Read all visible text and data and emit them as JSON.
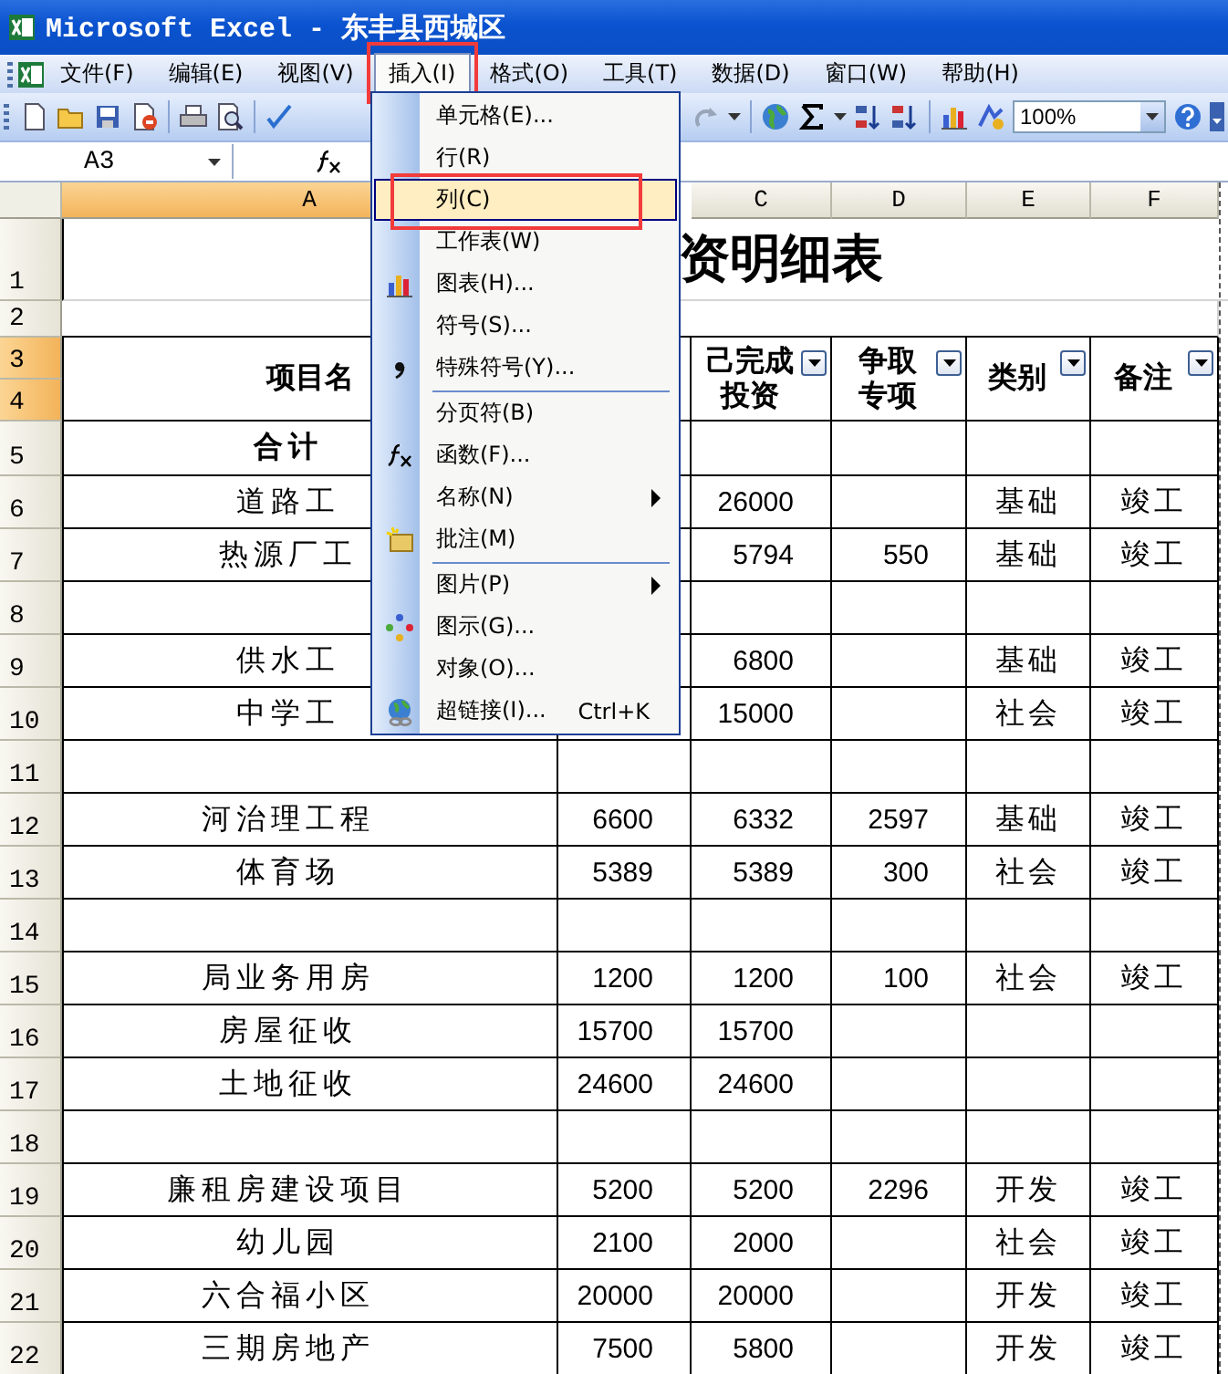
{
  "window": {
    "title": "Microsoft Excel - 东丰县西城区"
  },
  "menu_bar": [
    {
      "label": "文件(F)",
      "selected": false,
      "annotated": false
    },
    {
      "label": "编辑(E)",
      "selected": false,
      "annotated": false
    },
    {
      "label": "视图(V)",
      "selected": false,
      "annotated": false
    },
    {
      "label": "插入(I)",
      "selected": true,
      "annotated": true
    },
    {
      "label": "格式(O)",
      "selected": false,
      "annotated": false
    },
    {
      "label": "工具(T)",
      "selected": false,
      "annotated": false
    },
    {
      "label": "数据(D)",
      "selected": false,
      "annotated": false
    },
    {
      "label": "窗口(W)",
      "selected": false,
      "annotated": false
    },
    {
      "label": "帮助(H)",
      "selected": false,
      "annotated": false
    }
  ],
  "toolbar": {
    "zoom": "100%"
  },
  "formula_bar": {
    "name_box": "A3"
  },
  "sheet": {
    "column_headers": {
      "a": {
        "label": "A",
        "selected": true
      },
      "c": {
        "label": "C",
        "selected": false
      },
      "d": {
        "label": "D",
        "selected": false
      },
      "e": {
        "label": "E",
        "selected": false
      },
      "f": {
        "label": "F",
        "selected": false
      }
    },
    "rows": [
      {
        "number": "1",
        "selected": false,
        "kind": "title",
        "title": "资明细表"
      },
      {
        "number": "2",
        "selected": false,
        "kind": "blank"
      },
      {
        "number": "3",
        "selected": true,
        "kind": "header",
        "a": {
          "lines": [
            "项目名"
          ],
          "filter": false
        },
        "c": {
          "lines": [
            "己完成",
            "投资"
          ],
          "filter": true
        },
        "d": {
          "lines": [
            "争取",
            "专项"
          ],
          "filter": true
        },
        "e": {
          "lines": [
            "类别"
          ],
          "filter": true
        },
        "f": {
          "lines": [
            "备注"
          ],
          "filter": true
        }
      },
      {
        "number": "4",
        "selected": true,
        "kind": "continued"
      },
      {
        "number": "5",
        "selected": false,
        "kind": "total",
        "a": "合计"
      },
      {
        "number": "6",
        "selected": false,
        "kind": "data",
        "a": "道路工",
        "c": "26000",
        "e": "基础",
        "f": "竣工"
      },
      {
        "number": "7",
        "selected": false,
        "kind": "data",
        "a": "热源厂工",
        "c": "5794",
        "d": "550",
        "e": "基础",
        "f": "竣工"
      },
      {
        "number": "8",
        "selected": false,
        "kind": "data"
      },
      {
        "number": "9",
        "selected": false,
        "kind": "data",
        "a": "供水工",
        "c": "6800",
        "e": "基础",
        "f": "竣工"
      },
      {
        "number": "10",
        "selected": false,
        "kind": "data",
        "a": "中学工",
        "c": "15000",
        "e": "社会",
        "f": "竣工"
      },
      {
        "number": "11",
        "selected": false,
        "kind": "data"
      },
      {
        "number": "12",
        "selected": false,
        "kind": "data",
        "a": "河治理工程",
        "b": "6600",
        "c": "6332",
        "d": "2597",
        "e": "基础",
        "f": "竣工"
      },
      {
        "number": "13",
        "selected": false,
        "kind": "data",
        "a": "体育场",
        "b": "5389",
        "c": "5389",
        "d": "300",
        "e": "社会",
        "f": "竣工"
      },
      {
        "number": "14",
        "selected": false,
        "kind": "data"
      },
      {
        "number": "15",
        "selected": false,
        "kind": "data",
        "a": "局业务用房",
        "b": "1200",
        "c": "1200",
        "d": "100",
        "e": "社会",
        "f": "竣工"
      },
      {
        "number": "16",
        "selected": false,
        "kind": "data",
        "a": "房屋征收",
        "b": "15700",
        "c": "15700"
      },
      {
        "number": "17",
        "selected": false,
        "kind": "data",
        "a": "土地征收",
        "b": "24600",
        "c": "24600"
      },
      {
        "number": "18",
        "selected": false,
        "kind": "data"
      },
      {
        "number": "19",
        "selected": false,
        "kind": "data",
        "a": "廉租房建设项目",
        "b": "5200",
        "c": "5200",
        "d": "2296",
        "e": "开发",
        "f": "竣工"
      },
      {
        "number": "20",
        "selected": false,
        "kind": "data",
        "a": "幼儿园",
        "b": "2100",
        "c": "2000",
        "e": "社会",
        "f": "竣工"
      },
      {
        "number": "21",
        "selected": false,
        "kind": "data",
        "a": "六合福小区",
        "b": "20000",
        "c": "20000",
        "e": "开发",
        "f": "竣工"
      },
      {
        "number": "22",
        "selected": false,
        "kind": "data",
        "a": "三期房地产",
        "b": "7500",
        "c": "5800",
        "e": "开发",
        "f": "竣工"
      }
    ]
  },
  "insert_menu": {
    "items": [
      {
        "label": "单元格(E)...",
        "kind": "plain",
        "selected": false,
        "annotated": false,
        "separator_before": false,
        "submenu": false
      },
      {
        "label": "行(R)",
        "kind": "plain",
        "selected": false,
        "annotated": false,
        "separator_before": false,
        "submenu": false
      },
      {
        "label": "列(C)",
        "kind": "plain",
        "selected": true,
        "annotated": true,
        "separator_before": false,
        "submenu": false
      },
      {
        "label": "工作表(W)",
        "kind": "plain",
        "selected": false,
        "annotated": false,
        "separator_before": false,
        "submenu": false
      },
      {
        "label": "图表(H)...",
        "kind": "chart",
        "selected": false,
        "annotated": false,
        "separator_before": false,
        "submenu": false
      },
      {
        "label": "符号(S)...",
        "kind": "plain",
        "selected": false,
        "annotated": false,
        "separator_before": false,
        "submenu": false
      },
      {
        "label": "特殊符号(Y)...",
        "kind": "symbol",
        "selected": false,
        "annotated": false,
        "separator_before": false,
        "submenu": false
      },
      {
        "label": "分页符(B)",
        "kind": "plain",
        "selected": false,
        "annotated": false,
        "separator_before": true,
        "submenu": false
      },
      {
        "label": "函数(F)...",
        "kind": "function",
        "selected": false,
        "annotated": false,
        "separator_before": false,
        "submenu": false
      },
      {
        "label": "名称(N)",
        "kind": "plain",
        "selected": false,
        "annotated": false,
        "separator_before": false,
        "submenu": true
      },
      {
        "label": "批注(M)",
        "kind": "comment",
        "selected": false,
        "annotated": false,
        "separator_before": false,
        "submenu": false
      },
      {
        "label": "图片(P)",
        "kind": "plain",
        "selected": false,
        "annotated": false,
        "separator_before": true,
        "submenu": true
      },
      {
        "label": "图示(G)...",
        "kind": "diagram",
        "selected": false,
        "annotated": false,
        "separator_before": false,
        "submenu": false
      },
      {
        "label": "对象(O)...",
        "kind": "plain",
        "selected": false,
        "annotated": false,
        "separator_before": false,
        "submenu": false
      },
      {
        "label": "超链接(I)...",
        "kind": "link",
        "selected": false,
        "annotated": false,
        "separator_before": false,
        "submenu": false,
        "shortcut": "Ctrl+K"
      }
    ]
  }
}
